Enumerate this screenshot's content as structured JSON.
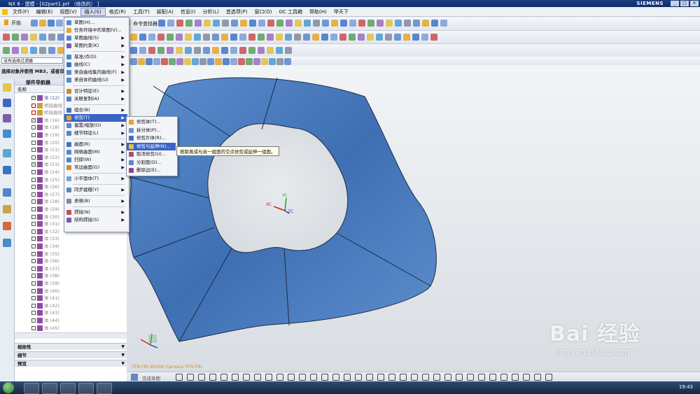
{
  "window": {
    "title": "NX 8 - 建模 - [02part1.prt （修改的） ]",
    "brand": "SIEMENS",
    "controls": [
      "_",
      "□",
      "×"
    ]
  },
  "menubar": [
    "文件(F)",
    "编辑(E)",
    "视图(V)",
    "插入(S)",
    "格式(R)",
    "工具(T)",
    "装配(A)",
    "信息(I)",
    "分析(L)",
    "首选项(P)",
    "窗口(O)",
    "GC 工具箱",
    "帮助(H)",
    "甲天下"
  ],
  "toolbar": {
    "start_label": "开始",
    "command_finder": "命令查找器"
  },
  "filter": {
    "value": "没有选择过滤器",
    "hint": "选择对象并使用 MB3，或者双"
  },
  "navigator": {
    "title": "部件导航器",
    "column": "名称",
    "rows": [
      {
        "label": "体 (12)",
        "check": true,
        "style": "blue"
      },
      {
        "label": "桥接曲线 (",
        "check": false,
        "style": "gray",
        "err": true
      },
      {
        "label": "桥接曲线 (",
        "check": false,
        "style": "gray",
        "err": true
      },
      {
        "label": "体 (16)",
        "check": true,
        "style": "gray"
      },
      {
        "label": "体 (18)",
        "check": false,
        "style": "gray"
      },
      {
        "label": "体 (19)",
        "check": false,
        "style": "gray"
      },
      {
        "label": "体 (20)",
        "check": false,
        "style": "gray"
      },
      {
        "label": "体 (21)",
        "check": false,
        "style": "gray"
      },
      {
        "label": "体 (22)",
        "check": false,
        "style": "gray"
      },
      {
        "label": "体 (23)",
        "check": true,
        "style": "gray"
      },
      {
        "label": "体 (24)",
        "check": false,
        "style": "gray"
      },
      {
        "label": "体 (25)",
        "check": false,
        "style": "gray"
      },
      {
        "label": "体 (26)",
        "check": false,
        "style": "gray"
      },
      {
        "label": "体 (27)",
        "check": false,
        "style": "gray"
      },
      {
        "label": "体 (28)",
        "check": false,
        "style": "gray"
      },
      {
        "label": "体 (29)",
        "check": false,
        "style": "gray"
      },
      {
        "label": "体 (30)",
        "check": false,
        "style": "gray"
      },
      {
        "label": "体 (31)",
        "check": false,
        "style": "gray"
      },
      {
        "label": "体 (32)",
        "check": false,
        "style": "gray"
      },
      {
        "label": "体 (33)",
        "check": false,
        "style": "gray"
      },
      {
        "label": "体 (34)",
        "check": false,
        "style": "gray"
      },
      {
        "label": "体 (35)",
        "check": false,
        "style": "gray"
      },
      {
        "label": "体 (36)",
        "check": false,
        "style": "gray"
      },
      {
        "label": "体 (37)",
        "check": false,
        "style": "gray"
      },
      {
        "label": "体 (38)",
        "check": false,
        "style": "gray"
      },
      {
        "label": "体 (39)",
        "check": false,
        "style": "gray"
      },
      {
        "label": "体 (40)",
        "check": false,
        "style": "gray"
      },
      {
        "label": "体 (41)",
        "check": false,
        "style": "gray"
      },
      {
        "label": "体 (42)",
        "check": false,
        "style": "gray"
      },
      {
        "label": "体 (43)",
        "check": false,
        "style": "gray"
      },
      {
        "label": "体 (44)",
        "check": false,
        "style": "gray"
      },
      {
        "label": "体 (45)",
        "check": false,
        "style": "gray"
      }
    ],
    "panels": [
      "相依性",
      "细节",
      "预览"
    ]
  },
  "insert_menu": [
    {
      "label": "草图(H)...",
      "arrow": false,
      "sep_after": false
    },
    {
      "label": "任务环境中的草图(V)...",
      "arrow": false,
      "sep_after": false
    },
    {
      "label": "草图曲线(S)",
      "arrow": true,
      "sep_after": false
    },
    {
      "label": "草图约束(K)",
      "arrow": true,
      "sep_after": true
    },
    {
      "label": "基准/点(D)",
      "arrow": true,
      "sep_after": false
    },
    {
      "label": "曲线(C)",
      "arrow": true,
      "sep_after": false
    },
    {
      "label": "来自曲线集的曲线(F)",
      "arrow": true,
      "sep_after": false
    },
    {
      "label": "来自体的曲线(U)",
      "arrow": true,
      "sep_after": true
    },
    {
      "label": "设计特征(E)",
      "arrow": true,
      "sep_after": false
    },
    {
      "label": "关联复制(A)",
      "arrow": true,
      "sep_after": true
    },
    {
      "label": "组合(B)",
      "arrow": true,
      "sep_after": false
    },
    {
      "label": "修剪(T)",
      "arrow": true,
      "sep_after": false,
      "hl": true
    },
    {
      "label": "偏置/缩放(O)",
      "arrow": true,
      "sep_after": false
    },
    {
      "label": "细节特征(L)",
      "arrow": true,
      "sep_after": true
    },
    {
      "label": "曲面(R)",
      "arrow": true,
      "sep_after": false
    },
    {
      "label": "网格曲面(M)",
      "arrow": true,
      "sep_after": false
    },
    {
      "label": "扫掠(W)",
      "arrow": true,
      "sep_after": false
    },
    {
      "label": "弯边曲面(G)",
      "arrow": true,
      "sep_after": true
    },
    {
      "label": "小平面体(T)",
      "arrow": true,
      "sep_after": true
    },
    {
      "label": "同步建模(Y)",
      "arrow": true,
      "sep_after": true
    },
    {
      "label": "表格(B)",
      "arrow": true,
      "sep_after": true
    },
    {
      "label": "焊接(N)",
      "arrow": true,
      "sep_after": false
    },
    {
      "label": "结构焊接(S)",
      "arrow": true,
      "sep_after": false
    }
  ],
  "trim_submenu": [
    {
      "label": "修剪体(T)...",
      "color": "#e9a12c"
    },
    {
      "label": "拆分体(P)...",
      "color": "#6f8fc9"
    },
    {
      "label": "修剪片体(R)...",
      "color": "#3f73c4"
    },
    {
      "label": "修剪与延伸(N)...",
      "color": "#e2c33a",
      "hl": true
    },
    {
      "label": "取消修剪(U)...",
      "color": "#b24b6a"
    },
    {
      "label": "分割面(D)...",
      "color": "#5b87c9"
    },
    {
      "label": "删除边(E)...",
      "color": "#8a3fa3"
    }
  ],
  "tooltip": "按距离或与另一组面的交点修剪或延伸一组面。",
  "graphics": {
    "status": "TFR-TRI WORK Camera TFR-TRI",
    "triad_labels": [
      "XC",
      "YC",
      "ZC"
    ],
    "surface_color": "#4d7fc2",
    "background_color": "#e9ecef"
  },
  "bottom_toolbar": {
    "label": "完成草图"
  },
  "taskbar": {
    "clock": "19:43"
  },
  "watermark": {
    "main": "Bai 经验",
    "url": "jingyan.baidu.com"
  }
}
